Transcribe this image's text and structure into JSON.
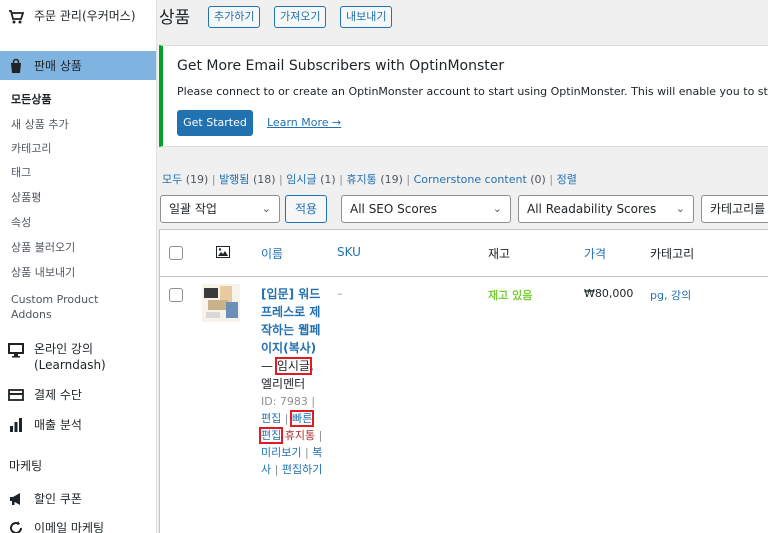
{
  "sidebar": {
    "order_management": "주문 관리(우커머스)",
    "products_menu": "판매 상품",
    "submenu": {
      "all_products": "모든상품",
      "add_new": "새 상품 추가",
      "categories": "카테고리",
      "tags": "태그",
      "reviews": "상품평",
      "attributes": "속성",
      "import": "상품 불러오기",
      "export": "상품 내보내기",
      "custom_addons": "Custom Product Addons"
    },
    "online_course": "온라인 강의 (Learndash)",
    "payment": "결제 수단",
    "analytics": "매출 분석",
    "marketing_section": "마케팅",
    "coupons": "할인 쿠폰",
    "email_marketing": "이메일 마케팅"
  },
  "header": {
    "title": "상품",
    "add_btn": "추가하기",
    "import_btn": "가져오기",
    "export_btn": "내보내기"
  },
  "notice": {
    "title": "Get More Email Subscribers with OptinMonster",
    "text": "Please connect to or create an OptinMonster account to start using OptinMonster. This will enable you to start turning",
    "button": "Get Started",
    "link": "Learn More →"
  },
  "filters": {
    "all": "모두",
    "all_count": "(19)",
    "published": "발행됨",
    "published_count": "(18)",
    "draft": "임시글",
    "draft_count": "(1)",
    "trash": "휴지통",
    "trash_count": "(19)",
    "cornerstone": "Cornerstone content",
    "cornerstone_count": "(0)",
    "sort": "정렬"
  },
  "bulk": {
    "action": "일괄 작업",
    "apply": "적용",
    "seo": "All SEO Scores",
    "readability": "All Readability Scores",
    "category": "카테고리를"
  },
  "table": {
    "headers": {
      "name": "이름",
      "sku": "SKU",
      "stock": "재고",
      "price": "가격",
      "categories": "카테고리"
    },
    "row": {
      "title": "[입문] 워드프레스로 제작하는 웹페이지(복사)",
      "dash": "—",
      "state": "임시글",
      "state_suffix": ",",
      "builder": "엘리멘터",
      "id": "ID: 7983",
      "edit": "편집",
      "quick_edit": "빠른 편집",
      "trash": "휴지통",
      "preview": "미리보기",
      "copy": "복사",
      "edit_with": "편집하기",
      "sku": "–",
      "stock": "재고 있음",
      "price": "₩80,000",
      "categories": "pg, 강의"
    }
  },
  "colors": {
    "accent": "#2271b1",
    "active_menu": "#7fb3e0",
    "in_stock": "#7ad03a",
    "highlight_box": "#e01b22",
    "notice_border": "#00a32a"
  }
}
